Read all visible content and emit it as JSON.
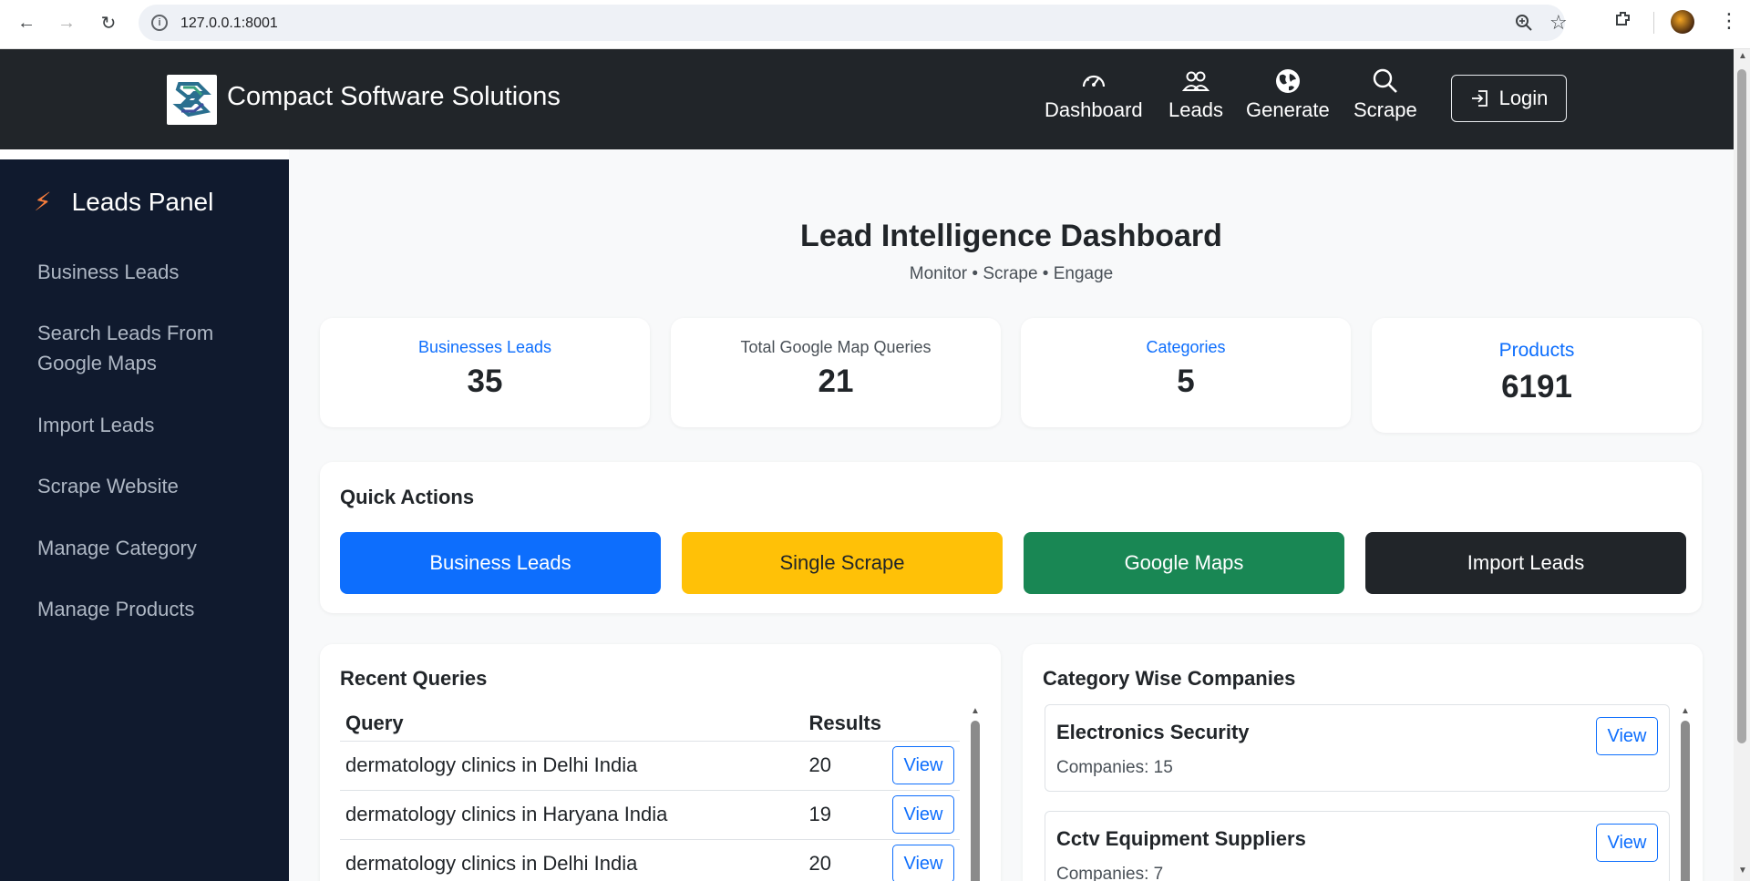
{
  "browser": {
    "url": "127.0.0.1:8001"
  },
  "navbar": {
    "brand": "Compact Software Solutions",
    "items": [
      {
        "label": "Dashboard",
        "icon": "speedometer-icon"
      },
      {
        "label": "Leads",
        "icon": "people-icon"
      },
      {
        "label": "Generate",
        "icon": "globe-icon"
      },
      {
        "label": "Scrape",
        "icon": "search-icon"
      }
    ],
    "login_label": "Login"
  },
  "sidebar": {
    "title": "Leads Panel",
    "items": [
      {
        "label": "Business Leads"
      },
      {
        "label": "Search Leads From Google Maps"
      },
      {
        "label": "Import Leads"
      },
      {
        "label": "Scrape Website"
      },
      {
        "label": "Manage Category"
      },
      {
        "label": "Manage Products"
      }
    ]
  },
  "main": {
    "title": "Lead Intelligence Dashboard",
    "subtitle": "Monitor • Scrape • Engage",
    "stats": [
      {
        "label": "Businesses Leads",
        "value": "35",
        "color": "#0d6efd"
      },
      {
        "label": "Total Google Map Queries",
        "value": "21",
        "color": "#495057"
      },
      {
        "label": "Categories",
        "value": "5",
        "color": "#0d6efd"
      },
      {
        "label": "Products",
        "value": "6191",
        "color": "#0d6efd"
      }
    ],
    "quick_actions": {
      "title": "Quick Actions",
      "buttons": [
        {
          "label": "Business Leads",
          "bg": "#0d6efd",
          "fg": "#ffffff"
        },
        {
          "label": "Single Scrape",
          "bg": "#ffc107",
          "fg": "#212529"
        },
        {
          "label": "Google Maps",
          "bg": "#198754",
          "fg": "#ffffff"
        },
        {
          "label": "Import Leads",
          "bg": "#212529",
          "fg": "#ffffff"
        }
      ]
    },
    "recent_queries": {
      "title": "Recent Queries",
      "headers": [
        "Query",
        "Results"
      ],
      "rows": [
        {
          "query": "dermatology clinics in Delhi India",
          "results": "20",
          "action": "View"
        },
        {
          "query": "dermatology clinics in Haryana India",
          "results": "19",
          "action": "View"
        },
        {
          "query": "dermatology clinics in Delhi India",
          "results": "20",
          "action": "View"
        }
      ]
    },
    "category_companies": {
      "title": "Category Wise Companies",
      "items": [
        {
          "name": "Electronics Security",
          "count": "Companies: 15",
          "action": "View"
        },
        {
          "name": "Cctv Equipment Suppliers",
          "count": "Companies: 7",
          "action": "View"
        }
      ]
    }
  }
}
